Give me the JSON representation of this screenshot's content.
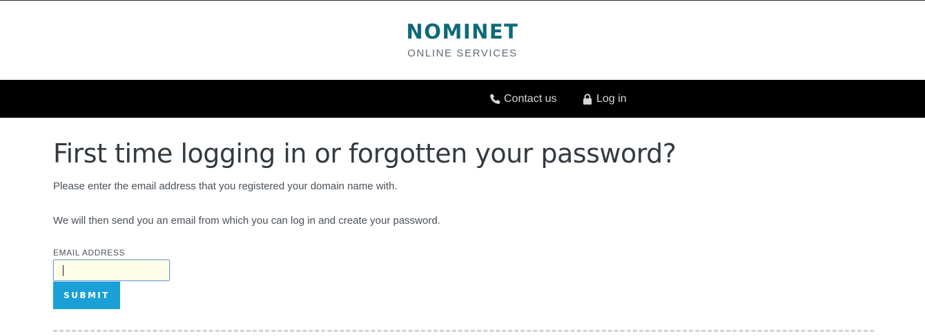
{
  "header": {
    "logo_text": "NOMINET",
    "logo_subtitle": "ONLINE SERVICES",
    "brand_color": "#0e6a78"
  },
  "nav": {
    "items": [
      {
        "label": "Contact us",
        "icon": "phone-icon"
      },
      {
        "label": "Log in",
        "icon": "lock-icon"
      }
    ],
    "background": "#000000"
  },
  "main": {
    "title": "First time logging in or forgotten your password?",
    "paragraph1": "Please enter the email address that you registered your domain name with.",
    "paragraph2": "We will then send you an email from which you can log in and create your password.",
    "email_label": "EMAIL ADDRESS",
    "email_value": "",
    "submit_label": "SUBMIT",
    "submit_color": "#1a9fd6"
  }
}
